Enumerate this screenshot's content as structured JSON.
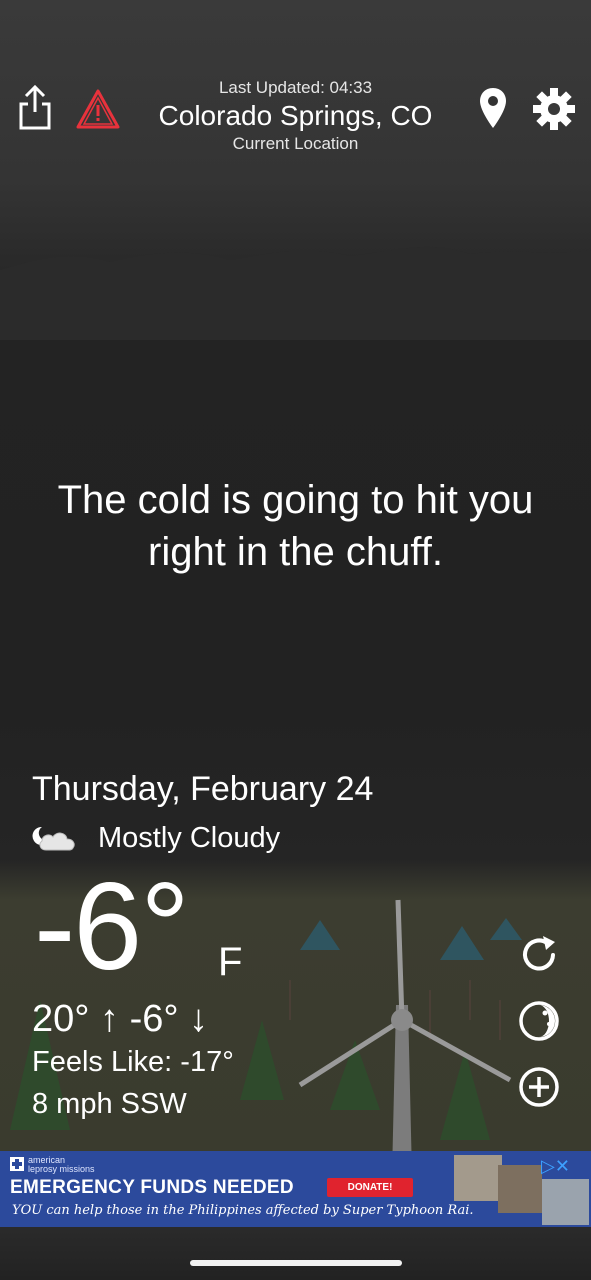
{
  "header": {
    "last_updated": "Last Updated: 04:33",
    "city": "Colorado Springs, CO",
    "current_location": "Current Location",
    "icons": [
      "share-icon",
      "alert-icon",
      "location-pin-icon",
      "gear-icon"
    ],
    "alert_color": "#e8323c"
  },
  "message": {
    "line1": "The cold is going to hit you",
    "line2": "right in the chuff."
  },
  "weather": {
    "date": "Thursday, February 24",
    "condition": "Mostly Cloudy",
    "condition_icon": "mostly-cloudy-night-icon",
    "temperature": "-6°",
    "unit": "F",
    "high_low": "20° ↑  -6° ↓",
    "feels_like": "Feels Like: -17°",
    "wind": "8 mph SSW",
    "side_icons": [
      "refresh-icon",
      "moon-phase-icon",
      "add-icon"
    ]
  },
  "ad": {
    "org_line1": "american",
    "org_line2": "leprosy missions",
    "title": "EMERGENCY FUNDS NEEDED",
    "button": "DONATE!",
    "subtitle": "YOU can help those in the Philippines affected by Super Typhoon Rai.",
    "controls": "▷✕"
  }
}
